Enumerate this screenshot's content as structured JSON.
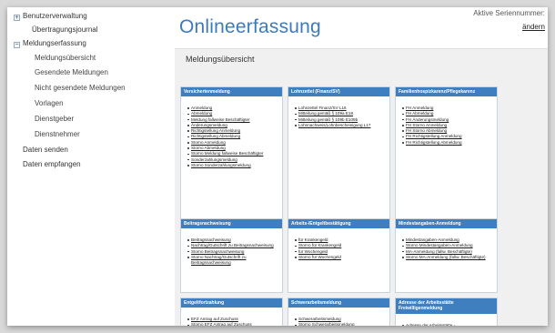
{
  "sidebar": {
    "items": [
      {
        "label": "Benutzerverwaltung",
        "toggle": "+"
      },
      {
        "label": "Übertragungsjournal"
      },
      {
        "label": "Meldungserfassung",
        "toggle": "−"
      },
      {
        "label": "Meldungsübersicht"
      },
      {
        "label": "Gesendete Meldungen"
      },
      {
        "label": "Nicht gesendete Meldungen"
      },
      {
        "label": "Vorlagen"
      },
      {
        "label": "Dienstgeber"
      },
      {
        "label": "Dienstnehmer"
      },
      {
        "label": "Daten senden"
      },
      {
        "label": "Daten empfangen"
      }
    ]
  },
  "header": {
    "title": "Onlineerfassung",
    "serien_label": "Aktive Seriennummer:",
    "serien_link": "ändern"
  },
  "panel": {
    "title": "Meldungsübersicht"
  },
  "cards": [
    {
      "title": "Versichertenmeldung",
      "links": [
        "Anmeldung",
        "Abmeldung",
        "Meldung fallweise Beschäftigter",
        "Änderungsmeldung",
        "Richtigstellung Anmeldung",
        "Richtigstellung Abmeldung",
        "Storno Anmeldung",
        "Storno Abmeldung",
        "Storno Meldung fallweise Beschäftigter",
        "Sonderzahlungsmeldung",
        "Storno Sonderzahlungsmeldung"
      ]
    },
    {
      "title": "Lohnzettel (Finanz/SV)",
      "links": [
        "Lohnzettel Finanz/SV L16",
        "Mitteilung gemäß § 109a E18",
        "Mitteilung gemäß § 109b E109b",
        "Lohnnachweis/Lohnbescheinigung L17"
      ]
    },
    {
      "title": "Familienhospizkarenz/Pflegekarenz",
      "links": [
        "FH Anmeldung",
        "FH Abmeldung",
        "FH Änderungsmeldung",
        "FH Storno Anmeldung",
        "FH Storno Abmeldung",
        "FH Richtigstellung Anmeldung",
        "FH Richtigstellung Abmeldung"
      ]
    },
    {
      "title": "Beitragsnachweisung",
      "links": [
        "Beitragsnachweisung",
        "Nachtrag/Gutschrift zu Beitragsnachweisung",
        "Storno Beitragsnachweisung",
        "Storno Nachtrag/Gutschrift zu Beitragsnachweisung"
      ]
    },
    {
      "title": "Arbeits-/Entgeltbestätigung",
      "links": [
        "für Krankengeld",
        "Storno für Krankengeld",
        "für Wochengeld",
        "Storno für Wochengeld"
      ]
    },
    {
      "title": "Mindestangaben-Anmeldung",
      "links": [
        "Mindestangaben-Anmeldung",
        "Storno Mindestangaben-Anmeldung",
        "MA-Anmeldung (fallw. Beschäftigte)",
        "Storno MA-Anmeldung (fallw. Beschäftigte)"
      ]
    },
    {
      "title": "Entgeltfortzahlung",
      "links": [
        "EFZ Antrag auf Zuschuss",
        "Storno EFZ Antrag auf Zuschuss"
      ]
    },
    {
      "title": "Schwerarbeitsmeldung",
      "links": [
        "Schwerarbeitsmeldung",
        "Storno Schwerarbeitsmeldung"
      ]
    },
    {
      "title": "Adresse der Arbeitsstätte Freiwilligenmeldung",
      "links": [
        "Adresse der Arbeitsstätte -"
      ]
    }
  ]
}
